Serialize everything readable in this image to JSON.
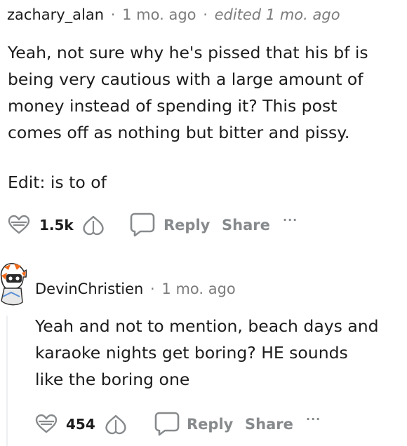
{
  "comment1": {
    "username": "zachary_alan",
    "separator": "·",
    "time": "1 mo. ago",
    "edited": "edited 1 mo. ago",
    "lines": [
      "Yeah, not sure why he's pissed that his bf is",
      "being very cautious with a large amount of",
      "money instead of spending it? This post",
      "comes off as nothing but bitter and pissy."
    ],
    "edit_note": "Edit: is to of",
    "actions": {
      "upvote_icon": "heart-upvote-icon",
      "score": "1.5k",
      "downvote_icon": "downvote-icon",
      "reply_icon": "comment-bubble-icon",
      "reply_label": "Reply",
      "share_label": "Share",
      "more_label": "···"
    }
  },
  "comment2": {
    "username": "DevinChristien",
    "separator": "·",
    "time": "1 mo. ago",
    "avatar": "avatar-icon",
    "lines": [
      "Yeah and not to mention, beach days and",
      "karaoke nights get boring? HE sounds",
      "like the boring one"
    ],
    "actions": {
      "upvote_icon": "heart-upvote-icon",
      "score": "454",
      "downvote_icon": "downvote-icon",
      "reply_icon": "comment-bubble-icon",
      "reply_label": "Reply",
      "share_label": "Share",
      "more_label": "···"
    }
  },
  "colors": {
    "text": "#1c1c1c",
    "muted": "#7c7c7c",
    "action": "#878a8c",
    "thread_line": "#edeff1",
    "avatar_orange": "#f26a1b"
  }
}
